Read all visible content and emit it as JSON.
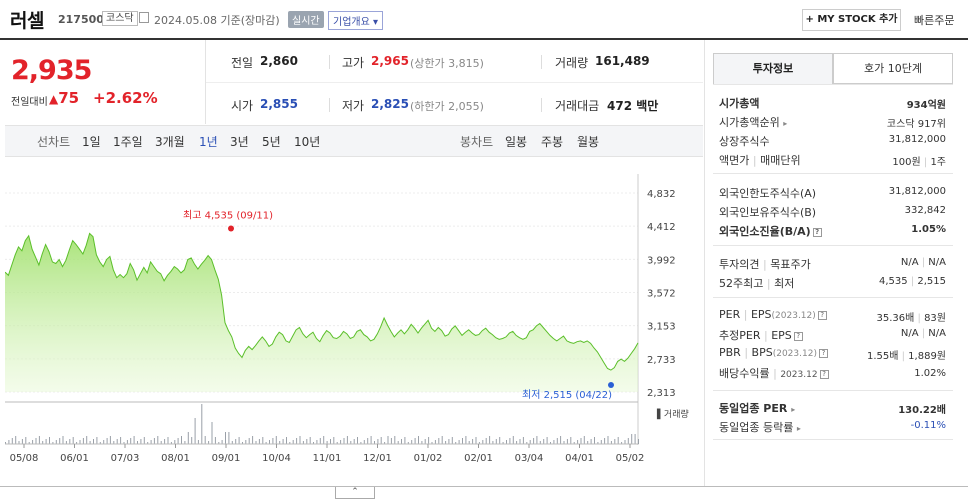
{
  "header": {
    "name": "러셀",
    "code": "217500",
    "market": "코스닥",
    "date": "2024.05.08",
    "basis": "기준(장마감)",
    "realtime": "실시간",
    "overview": "기업개요",
    "mystock": "+ MY STOCK 추가",
    "quick_order": "빠른주문"
  },
  "price": {
    "current": "2,935",
    "vs_label": "전일대비",
    "change": "75",
    "change_pct": "+2.62%"
  },
  "stats": {
    "prev_label": "전일",
    "prev": "2,860",
    "high_label": "고가",
    "high": "2,965",
    "upper_limit": "(상한가 3,815)",
    "volume_label": "거래량",
    "volume": "161,489",
    "open_label": "시가",
    "open": "2,855",
    "low_label": "저가",
    "low": "2,825",
    "lower_limit": "(하한가 2,055)",
    "amount_label": "거래대금",
    "amount": "472 백만"
  },
  "tabs": {
    "line_label": "선차트",
    "line_periods": [
      "1일",
      "1주일",
      "3개월",
      "1년",
      "3년",
      "5년",
      "10년"
    ],
    "active": "1년",
    "candle_label": "봉차트",
    "candle_periods": [
      "일봉",
      "주봉",
      "월봉"
    ]
  },
  "chart_data": {
    "type": "area",
    "y_ticks": [
      "4,832",
      "4,412",
      "3,992",
      "3,572",
      "3,153",
      "2,733",
      "2,313"
    ],
    "ylim": [
      2313,
      4832
    ],
    "x_ticks": [
      "05/08",
      "06/01",
      "07/03",
      "08/01",
      "09/01",
      "10/04",
      "11/01",
      "12/01",
      "01/02",
      "02/01",
      "03/04",
      "04/01",
      "05/02"
    ],
    "high_annotation": "최고 4,535 (09/11)",
    "low_annotation": "최저 2,515 (04/22)",
    "volume_label": "거래량",
    "series": [
      {
        "values": [
          3830,
          3790,
          3920,
          4050,
          4150,
          4100,
          4230,
          4290,
          4120,
          4020,
          3920,
          4060,
          4180,
          4090,
          3960,
          3940,
          3990,
          3900,
          3980,
          4110,
          4230,
          4180,
          4120,
          4060,
          4170,
          4320,
          4280,
          4050,
          3960,
          3900,
          3990,
          4030,
          3860,
          3760,
          3800,
          3760,
          3810,
          3940,
          3860,
          3730,
          3810,
          3890,
          3820,
          3960,
          3900,
          3840,
          3810,
          3720,
          3790,
          3840,
          3900,
          3870,
          3820,
          3860,
          3990,
          4010,
          3930,
          3870,
          3930,
          3980,
          4040,
          3990,
          3860,
          3740,
          3540,
          3190,
          3090,
          3010,
          2870,
          2800,
          2750,
          2840,
          2890,
          2850,
          2900,
          2960,
          3010,
          2960,
          2890,
          2920,
          3010,
          3070,
          3040,
          2960,
          2940,
          3020,
          3100,
          3130,
          3050,
          3000,
          3040,
          3070,
          2990,
          2950,
          3030,
          3090,
          3060,
          3000,
          2990,
          3020,
          3080,
          3050,
          2990,
          3010,
          3080,
          3100,
          3040,
          3010,
          2960,
          2980,
          3050,
          3140,
          3250,
          3160,
          3080,
          3010,
          3060,
          3100,
          3050,
          3100,
          3170,
          3120,
          3060,
          3120,
          3170,
          3220,
          3120,
          3080,
          3130,
          3090,
          3020,
          3040,
          3110,
          3150,
          3090,
          3030,
          3070,
          3100,
          3060,
          3030,
          3040,
          3090,
          3120,
          3070,
          3040,
          3000,
          2980,
          2990,
          3010,
          3060,
          3080,
          3030,
          3000,
          2980,
          3000,
          3080,
          3100,
          3150,
          3180,
          3130,
          3080,
          3030,
          2990,
          2960,
          2990,
          3020,
          2960,
          2940,
          2930,
          2950,
          2960,
          2940,
          2960,
          2930,
          2870,
          2820,
          2750,
          2680,
          2610,
          2590,
          2620,
          2700,
          2730,
          2700,
          2740,
          2800,
          2860,
          2935
        ],
        "ylim": [
          2313,
          4832
        ]
      }
    ]
  },
  "right_panel": {
    "tab_active": "투자정보",
    "tab_other": "호가 10단계",
    "market_cap_label": "시가총액",
    "market_cap": "934억원",
    "rank_label": "시가총액순위",
    "rank": "코스닥 917위",
    "shares_label": "상장주식수",
    "shares": "31,812,000",
    "face_label": "액면가",
    "unit_label": "매매단위",
    "face": "100원",
    "unit": "1주",
    "foreign_limit_label": "외국인한도주식수(A)",
    "foreign_limit": "31,812,000",
    "foreign_hold_label": "외국인보유주식수(B)",
    "foreign_hold": "332,842",
    "foreign_rate_label": "외국인소진율(B/A)",
    "foreign_rate": "1.05%",
    "opinion_label": "투자의견",
    "target_label": "목표주가",
    "opinion": "N/A",
    "target": "N/A",
    "w52_label": "52주최고",
    "w52_low_label": "최저",
    "w52_high": "4,535",
    "w52_low": "2,515",
    "per_label": "PER",
    "eps_label": "EPS",
    "per_year": "(2023.12)",
    "per": "35.36배",
    "eps": "83원",
    "est_per_label": "추정PER",
    "est_eps_label": "EPS",
    "est_per": "N/A",
    "est_eps": "N/A",
    "pbr_label": "PBR",
    "bps_label": "BPS",
    "pbr_year": "(2023.12)",
    "pbr": "1.55배",
    "bps": "1,889원",
    "div_label": "배당수익률",
    "div_year": "2023.12",
    "div": "1.02%",
    "sector_per_label": "동일업종 PER",
    "sector_per": "130.22배",
    "sector_chg_label": "동일업종 등락률",
    "sector_chg": "-0.11%"
  }
}
